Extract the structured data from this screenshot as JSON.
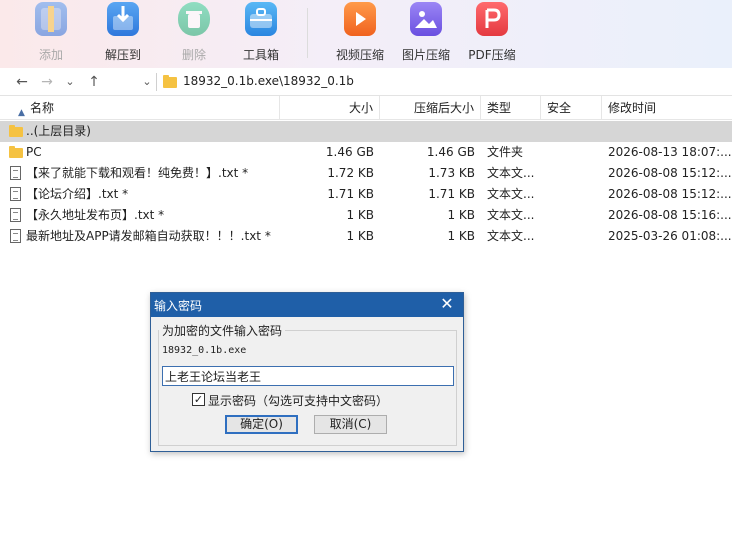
{
  "toolbar": {
    "buttons": [
      {
        "label": "添加",
        "icon": "add-archive-icon",
        "enabled": false,
        "color": "#3b7fe0"
      },
      {
        "label": "解压到",
        "icon": "extract-to-icon",
        "enabled": true,
        "color": "#3a8be8"
      },
      {
        "label": "删除",
        "icon": "delete-icon",
        "enabled": false,
        "color": "#21b67a"
      },
      {
        "label": "工具箱",
        "icon": "toolbox-icon",
        "enabled": true,
        "color": "#2f95e8"
      },
      {
        "label": "视频压缩",
        "icon": "video-compress-icon",
        "enabled": true,
        "color": "#f57c2a"
      },
      {
        "label": "图片压缩",
        "icon": "image-compress-icon",
        "enabled": true,
        "color": "#7a5ee8"
      },
      {
        "label": "PDF压缩",
        "icon": "pdf-compress-icon",
        "enabled": true,
        "color": "#f0464b"
      }
    ]
  },
  "address": {
    "path": "18932_0.1b.exe\\18932_0.1b"
  },
  "columns": {
    "name": "名称",
    "size": "大小",
    "packed": "压缩后大小",
    "type": "类型",
    "security": "安全",
    "modified": "修改时间"
  },
  "rows": [
    {
      "name": "..(上层目录)",
      "size": "",
      "packed": "",
      "type": "",
      "modified": "",
      "icon": "folder-icon"
    },
    {
      "name": "PC",
      "size": "1.46 GB",
      "packed": "1.46 GB",
      "type": "文件夹",
      "modified": "2026-08-13 18:07:...",
      "icon": "folder-icon"
    },
    {
      "name": "【来了就能下载和观看！纯免费！】.txt *",
      "size": "1.72 KB",
      "packed": "1.73 KB",
      "type": "文本文...",
      "modified": "2026-08-08 15:12:...",
      "icon": "text-file-icon"
    },
    {
      "name": "【论坛介绍】.txt *",
      "size": "1.71 KB",
      "packed": "1.71 KB",
      "type": "文本文...",
      "modified": "2026-08-08 15:12:...",
      "icon": "text-file-icon"
    },
    {
      "name": "【永久地址发布页】.txt *",
      "size": "1 KB",
      "packed": "1 KB",
      "type": "文本文...",
      "modified": "2026-08-08 15:16:...",
      "icon": "text-file-icon"
    },
    {
      "name": "最新地址及APP请发邮箱自动获取！！！.txt *",
      "size": "1 KB",
      "packed": "1 KB",
      "type": "文本文...",
      "modified": "2025-03-26 01:08:...",
      "icon": "text-file-icon"
    }
  ],
  "dialog": {
    "title": "输入密码",
    "close": "✕",
    "group_label": "为加密的文件输入密码",
    "file": "18932_0.1b.exe",
    "password": "上老王论坛当老王",
    "show_password_label": "显示密码（勾选可支持中文密码）",
    "show_password_checked": "✓",
    "ok": "确定(O)",
    "cancel": "取消(C)"
  }
}
